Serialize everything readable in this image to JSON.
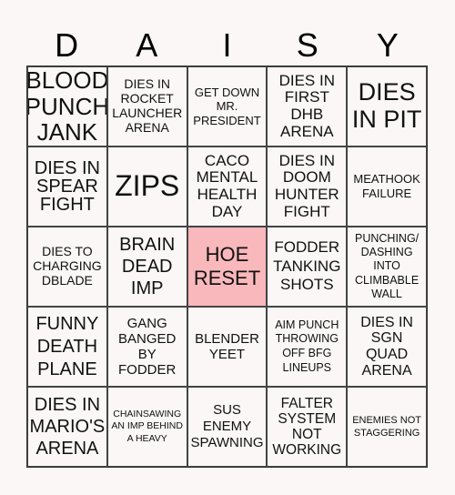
{
  "title_letters": [
    "D",
    "A",
    "I",
    "S",
    "Y"
  ],
  "free_cell_color": "#f9b8bb",
  "cells": [
    [
      "BLOOD PUNCH JANK",
      "DIES IN ROCKET LAUNCHER ARENA",
      "GET DOWN MR. PRESIDENT",
      "DIES IN FIRST DHB ARENA",
      "DIES IN PIT"
    ],
    [
      "DIES IN SPEAR FIGHT",
      "ZIPS",
      "CACO MENTAL HEALTH DAY",
      "DIES IN DOOM HUNTER FIGHT",
      "MEATHOOK FAILURE"
    ],
    [
      "DIES TO CHARGING DBLADE",
      "BRAIN DEAD IMP",
      "HOE RESET",
      "FODDER TANKING SHOTS",
      "PUNCHING/ DASHING INTO CLIMBABLE WALL"
    ],
    [
      "FUNNY DEATH PLANE",
      "GANG BANGED BY FODDER",
      "BLENDER YEET",
      "AIM PUNCH THROWING OFF BFG LINEUPS",
      "DIES IN SGN QUAD ARENA"
    ],
    [
      "DIES IN MARIO'S ARENA",
      "CHAINSAWING AN IMP BEHIND A HEAVY",
      "SUS ENEMY SPAWNING",
      "FALTER SYSTEM NOT WORKING",
      "ENEMIES NOT STAGGERING"
    ]
  ]
}
